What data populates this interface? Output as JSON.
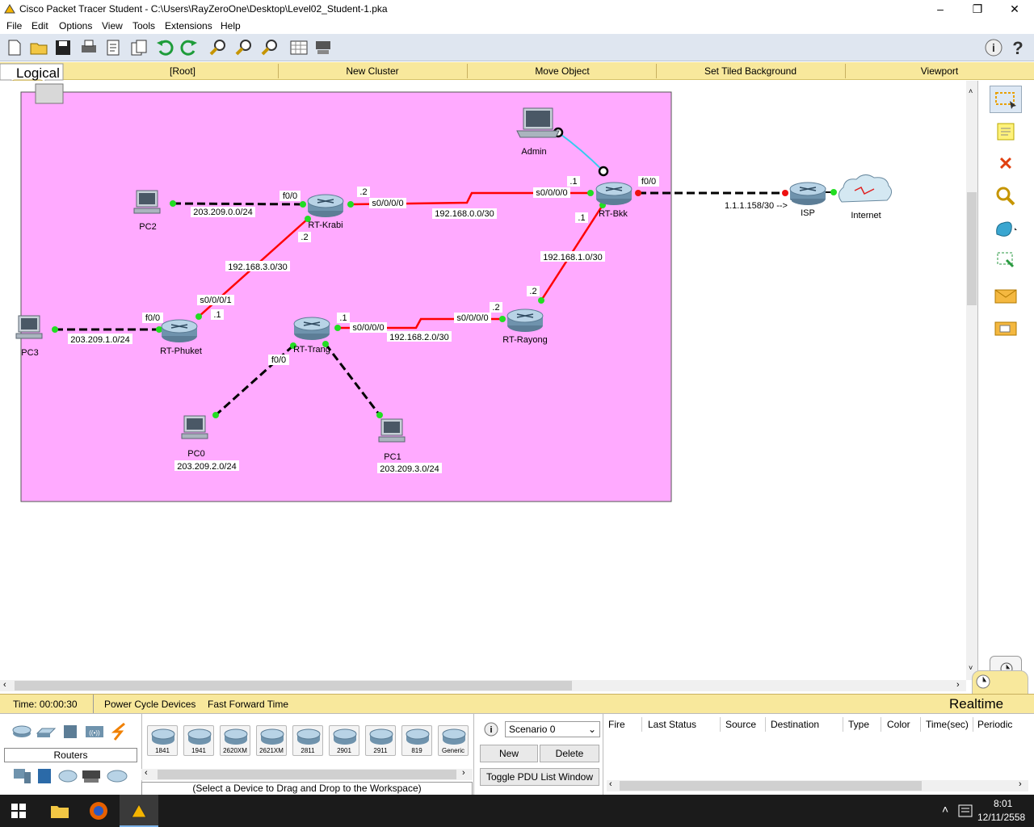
{
  "window": {
    "title": "Cisco Packet Tracer Student - C:\\Users\\RayZeroOne\\Desktop\\Level02_Student-1.pka",
    "minimize": "–",
    "maximize": "❐",
    "close": "✕"
  },
  "menu": [
    "File",
    "Edit",
    "Options",
    "View",
    "Tools",
    "Extensions",
    "Help"
  ],
  "nav": {
    "mode": "Logical",
    "root": "[Root]",
    "new_cluster": "New Cluster",
    "move_object": "Move Object",
    "set_bg": "Set Tiled Background",
    "viewport": "Viewport"
  },
  "topology": {
    "devices": {
      "admin": "Admin",
      "pc2": "PC2",
      "pc3": "PC3",
      "pc0": "PC0",
      "pc1": "PC1",
      "rt_krabi": "RT-Krabi",
      "rt_bkk": "RT-Bkk",
      "rt_phuket": "RT-Phuket",
      "rt_trang": "RT-Trang",
      "rt_rayong": "RT-Rayong",
      "isp": "ISP",
      "internet": "Internet"
    },
    "labels": {
      "net_pc2": "203.209.0.0/24",
      "net_pc3": "203.209.1.0/24",
      "net_pc0": "203.209.2.0/24",
      "net_pc1": "203.209.3.0/24",
      "net_krabi_bkk": "192.168.0.0/30",
      "net_krabi_phuket": "192.168.3.0/30",
      "net_bkk_rayong": "192.168.1.0/30",
      "net_trang_rayong": "192.168.2.0/30",
      "isp_link": "1.1.1.158/30 -->",
      "krabi_f00": "f0/0",
      "krabi_s000": "s0/0/0/0",
      "krabi_dot2a": ".2",
      "krabi_dot2b": ".2",
      "bkk_s000": "s0/0/0/0",
      "bkk_dot1a": ".1",
      "bkk_dot1b": ".1",
      "bkk_f00": "f0/0",
      "phuket_s001": "s0/0/0/1",
      "phuket_dot1": ".1",
      "phuket_f00": "f0/0",
      "trang_s000": "s0/0/0/0",
      "trang_dot1": ".1",
      "trang_f00": "f0/0",
      "rayong_s000": "s0/0/0/0",
      "rayong_dot2a": ".2",
      "rayong_dot2b": ".2"
    }
  },
  "status": {
    "time": "Time: 00:00:30",
    "power_cycle": "Power Cycle Devices",
    "fast_forward": "Fast Forward Time",
    "mode": "Realtime"
  },
  "device_panel": {
    "category": "Routers",
    "hint": "(Select a Device to Drag and Drop to the Workspace)",
    "models": [
      "1841",
      "1941",
      "2620XM",
      "2621XM",
      "2811",
      "2901",
      "2911",
      "819",
      "Generic"
    ]
  },
  "scenario": {
    "selected": "Scenario 0",
    "new": "New",
    "delete": "Delete",
    "toggle": "Toggle PDU List Window"
  },
  "pdu_columns": [
    "Fire",
    "Last Status",
    "Source",
    "Destination",
    "Type",
    "Color",
    "Time(sec)",
    "Periodic"
  ],
  "tray": {
    "time": "8:01",
    "date": "12/11/2558"
  },
  "colors": {
    "cluster_bg": "#ffaaff",
    "serial_link": "#ff0000",
    "ethernet_link": "#000000",
    "console_link": "#33ccee",
    "nav_bg": "#f8e89c",
    "port_up": "#22dd22",
    "port_down": "#ee1111"
  }
}
